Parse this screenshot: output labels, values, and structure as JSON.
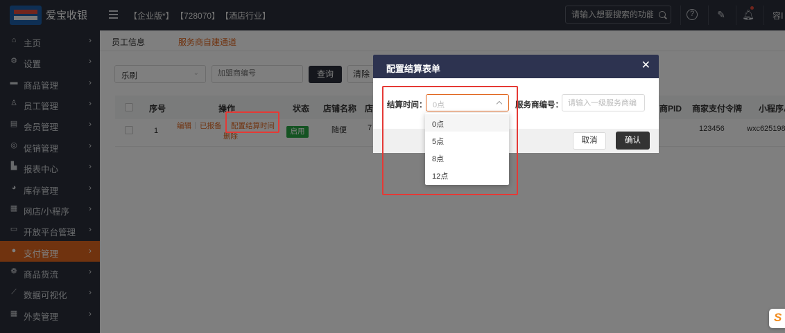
{
  "app": {
    "title": "爱宝收银",
    "tags": [
      "【企业版*】",
      "【728070】",
      "【酒店行业】"
    ]
  },
  "topbar": {
    "search_placeholder": "请输入想要搜索的功能",
    "user": "容Ⅰ"
  },
  "sidebar": {
    "items": [
      {
        "label": "主页",
        "icon": "home-icon",
        "active": false
      },
      {
        "label": "设置",
        "icon": "settings-icon",
        "active": false
      },
      {
        "label": "商品管理",
        "icon": "goods-icon",
        "active": false
      },
      {
        "label": "员工管理",
        "icon": "staff-icon",
        "active": false
      },
      {
        "label": "会员管理",
        "icon": "member-icon",
        "active": false
      },
      {
        "label": "促销管理",
        "icon": "promotion-icon",
        "active": false
      },
      {
        "label": "报表中心",
        "icon": "report-icon",
        "active": false
      },
      {
        "label": "库存管理",
        "icon": "inventory-icon",
        "active": false
      },
      {
        "label": "网店/小程序",
        "icon": "shop-icon",
        "active": false
      },
      {
        "label": "开放平台管理",
        "icon": "platform-icon",
        "active": false
      },
      {
        "label": "支付管理",
        "icon": "payment-icon",
        "active": true
      },
      {
        "label": "商品货流",
        "icon": "logistics-icon",
        "active": false
      },
      {
        "label": "数据可视化",
        "icon": "chart-icon",
        "active": false
      },
      {
        "label": "外卖管理",
        "icon": "delivery-icon",
        "active": false
      }
    ]
  },
  "tabs": [
    {
      "label": "员工信息",
      "active": false
    },
    {
      "label": "服务商自建通道",
      "active": true
    }
  ],
  "filters": {
    "store_value": "乐刷",
    "merchant_placeholder": "加盟商编号",
    "query_label": "查询",
    "clear_label": "清除"
  },
  "table": {
    "headers": [
      "序号",
      "操作",
      "状态",
      "店铺名称",
      "店",
      "商PID",
      "商家支付令牌",
      "小程序A"
    ],
    "rows": [
      {
        "index": "1",
        "ops": [
          "编辑",
          "已报备",
          "配置结算时间",
          "删除"
        ],
        "status": "启用",
        "store_name": "随便",
        "store_code": "7",
        "pay_token": "123456",
        "miniapp": "wxc625198"
      }
    ]
  },
  "modal": {
    "title": "配置结算表单",
    "settle_label": "结算时间：",
    "settle_value": "0点",
    "provider_label": "服务商编号：",
    "provider_placeholder": "请输入一级服务商编",
    "cancel_label": "取消",
    "ok_label": "确认"
  },
  "dropdown": {
    "options": [
      "0点",
      "5点",
      "8点",
      "12点"
    ],
    "selected": "0点"
  },
  "colors": {
    "accent": "#e0661f",
    "sidebar_bg": "#2b2f3a",
    "modal_header": "#2d3350",
    "status_green": "#29a745",
    "highlight_red": "#e53935"
  }
}
